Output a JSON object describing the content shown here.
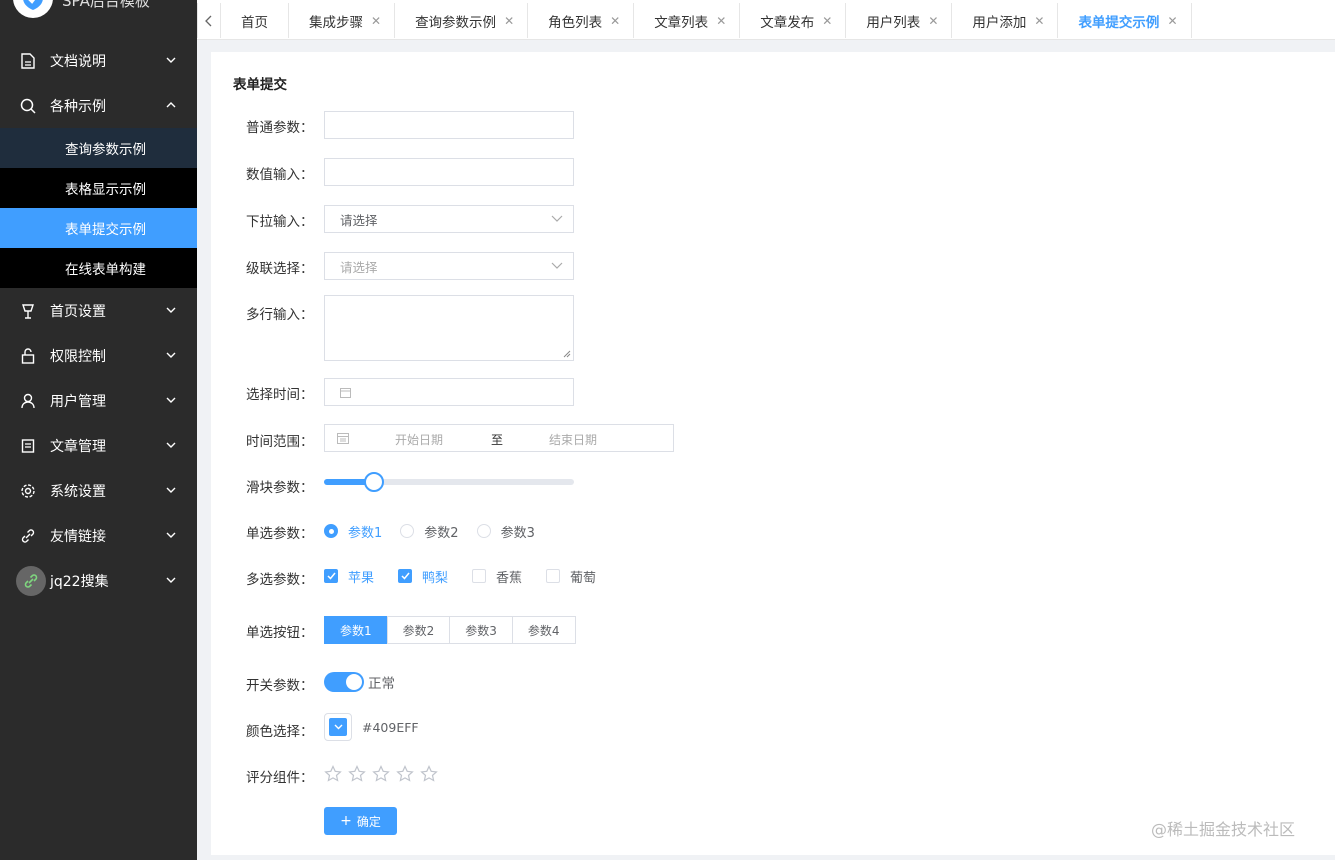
{
  "app": {
    "title": "SPA后台模板"
  },
  "sidebar": {
    "items": [
      {
        "label": "文档说明",
        "icon": "document-icon"
      },
      {
        "label": "各种示例",
        "icon": "search-icon"
      },
      {
        "label": "首页设置",
        "icon": "lamp-icon"
      },
      {
        "label": "权限控制",
        "icon": "lock-icon"
      },
      {
        "label": "用户管理",
        "icon": "user-icon"
      },
      {
        "label": "文章管理",
        "icon": "article-icon"
      },
      {
        "label": "系统设置",
        "icon": "gear-icon"
      },
      {
        "label": "友情链接",
        "icon": "link-icon"
      },
      {
        "label": "jq22搜集",
        "icon": "link-icon"
      }
    ],
    "submenu": [
      "查询参数示例",
      "表格显示示例",
      "表单提交示例",
      "在线表单构建"
    ]
  },
  "tabs": [
    "首页",
    "集成步骤",
    "查询参数示例",
    "角色列表",
    "文章列表",
    "文章发布",
    "用户列表",
    "用户添加",
    "表单提交示例"
  ],
  "form": {
    "title": "表单提交",
    "labels": {
      "normal": "普通参数：",
      "number": "数值输入：",
      "select": "下拉输入：",
      "cascade": "级联选择：",
      "textarea": "多行输入：",
      "time": "选择时间：",
      "range": "时间范围：",
      "slider": "滑块参数：",
      "radio": "单选参数：",
      "checkbox": "多选参数：",
      "radio_button": "单选按钮：",
      "switch": "开关参数：",
      "color": "颜色选择：",
      "rate": "评分组件："
    },
    "select_value": "请选择",
    "cascade_placeholder": "请选择",
    "range_start": "开始日期",
    "range_sep": "至",
    "range_end": "结束日期",
    "slider_value": 0.2,
    "radios": [
      "参数1",
      "参数2",
      "参数3"
    ],
    "radio_selected": 0,
    "checkboxes": [
      "苹果",
      "鸭梨",
      "香蕉",
      "葡萄"
    ],
    "checkbox_selected": [
      0,
      1
    ],
    "radio_buttons": [
      "参数1",
      "参数2",
      "参数3",
      "参数4"
    ],
    "radio_button_selected": 0,
    "switch_label": "正常",
    "color_value": "#409EFF",
    "rate_value": 0,
    "rate_max": 5,
    "submit_label": "确定",
    "submit_icon": "plus-icon"
  },
  "watermark": "@稀土掘金技术社区",
  "colors": {
    "accent": "#409eff",
    "sidebar": "#2b2b2b"
  }
}
